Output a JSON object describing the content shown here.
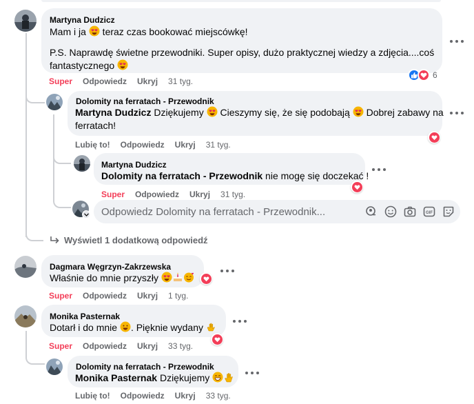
{
  "comment1": {
    "author": "Martyna Dudzicz",
    "line1_pre": "Mam i ja ",
    "line1_post": " teraz czas bookować miejscówkę!",
    "line2": "P.S. Naprawdę świetne przewodniki. Super opisy, dużo praktycznej wiedzy a zdjęcia....coś",
    "line3": "fantastycznego",
    "reaction": "Super",
    "reply": "Odpowiedz",
    "hide": "Ukryj",
    "time": "31 tyg.",
    "reaction_count": "6"
  },
  "reply1": {
    "author": "Dolomity na ferratach - Przewodnik",
    "mention": "Martyna Dudzicz",
    "text_a": " Dziękujemy ",
    "text_b": " Cieszymy się, że się podobają ",
    "text_c": " Dobrej zabawy na",
    "text_d": "ferratach!",
    "like": "Lubię to!",
    "reply": "Odpowiedz",
    "hide": "Ukryj",
    "time": "31 tyg."
  },
  "reply2": {
    "author": "Martyna Dudzicz",
    "mention": "Dolomity na ferratach - Przewodnik",
    "text": " nie mogę się doczekać !",
    "reaction": "Super",
    "reply": "Odpowiedz",
    "hide": "Ukryj",
    "time": "31 tyg."
  },
  "reply_box": {
    "placeholder": "Odpowiedz Dolomity na ferratach - Przewodnik..."
  },
  "more_replies": "Wyświetl 1 dodatkową odpowiedź",
  "comment2": {
    "author": "Dagmara Węgrzyn-Zakrzewska",
    "text": "Właśnie do mnie przyszły ",
    "reaction": "Super",
    "reply": "Odpowiedz",
    "hide": "Ukryj",
    "time": "1 tyg."
  },
  "comment3": {
    "author": "Monika Pasternak",
    "text_a": "Dotarł i do mnie ",
    "text_b": ". Pięknie wydany ",
    "reaction": "Super",
    "reply": "Odpowiedz",
    "hide": "Ukryj",
    "time": "33 tyg."
  },
  "reply3": {
    "author": "Dolomity na ferratach - Przewodnik",
    "mention": "Monika Pasternak",
    "text": " Dziękujemy ",
    "like": "Lubię to!",
    "reply": "Odpowiedz",
    "hide": "Ukryj",
    "time": "33 tyg."
  },
  "colors": {
    "bubble": "#f0f2f5",
    "secondary_text": "#65676b",
    "super": "#f33e58",
    "like_blue": "#1877f2",
    "thread_line": "#ced0d4"
  }
}
